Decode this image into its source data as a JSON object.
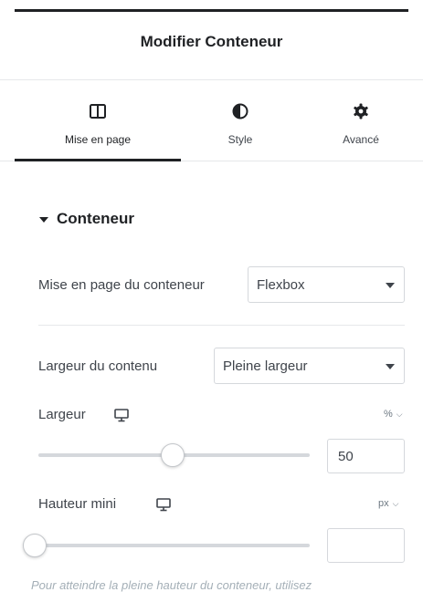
{
  "header": {
    "title": "Modifier Conteneur"
  },
  "tabs": [
    {
      "label": "Mise en page",
      "icon": "columns-icon",
      "active": true
    },
    {
      "label": "Style",
      "icon": "half-circle-icon",
      "active": false
    },
    {
      "label": "Avancé",
      "icon": "gear-icon",
      "active": false
    }
  ],
  "section": {
    "title": "Conteneur",
    "expanded": true
  },
  "container_layout": {
    "label": "Mise en page du conteneur",
    "value": "Flexbox"
  },
  "content_width": {
    "label": "Largeur du contenu",
    "value": "Pleine largeur"
  },
  "width": {
    "label": "Largeur",
    "unit": "%",
    "value": "50",
    "slider_fraction": 0.5,
    "device_icon": "desktop-icon"
  },
  "min_height": {
    "label": "Hauteur mini",
    "unit": "px",
    "value": "",
    "slider_fraction": 0.0,
    "device_icon": "desktop-icon"
  },
  "hint": {
    "text": "Pour atteindre la pleine hauteur du conteneur, utilisez"
  },
  "colors": {
    "accent_dark": "#1f2124",
    "text": "#3f444b",
    "border": "#d5d8dc",
    "muted": "#a4afb7"
  }
}
